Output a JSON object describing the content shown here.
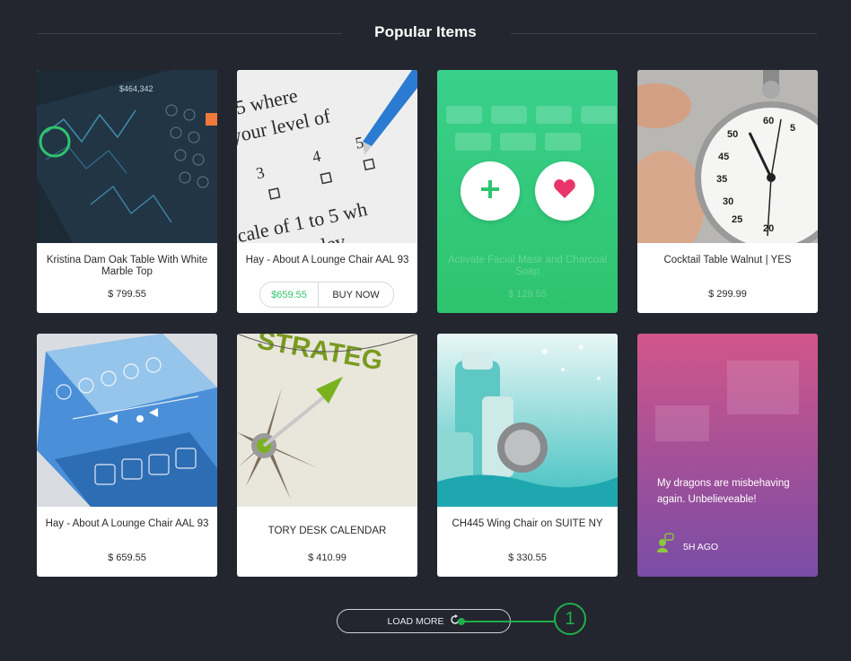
{
  "section": {
    "title": "Popular Items"
  },
  "row1": [
    {
      "name": "Kristina Dam Oak Table With White Marble Top",
      "price": "$ 799.55"
    },
    {
      "name": "Hay - About A Lounge Chair AAL 93",
      "price": "$659.55",
      "buy_label": "BUY NOW"
    },
    {
      "name": "Activate Facial Mask and Charcoal Soap",
      "price": "$ 129.55",
      "add_icon": "plus-icon",
      "like_icon": "heart-icon"
    },
    {
      "name": "Cocktail Table Walnut | YES",
      "price": "$ 299.99"
    }
  ],
  "row2": [
    {
      "name": "Hay - About A Lounge Chair AAL 93",
      "price": "$ 659.55"
    },
    {
      "name": "TORY DESK CALENDAR",
      "price": "$ 410.99"
    },
    {
      "name": "CH445 Wing Chair on SUITE NY",
      "price": "$ 330.55"
    },
    {
      "quote": "My dragons are misbehaving again. Unbelieveable!",
      "time": "5H AGO"
    }
  ],
  "load_more": {
    "label": "LOAD MORE",
    "icon": "refresh-icon"
  },
  "annotation": {
    "number": "1"
  },
  "colors": {
    "accent": "#2ec46d",
    "background": "#23262e",
    "heart": "#e8356b"
  }
}
